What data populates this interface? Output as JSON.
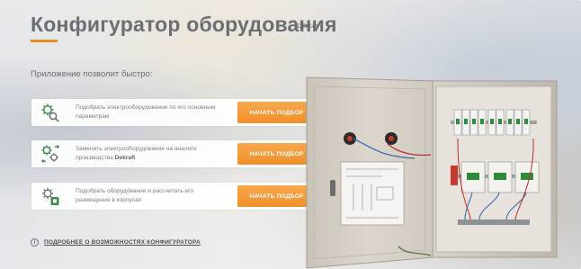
{
  "header": {
    "title": "Конфигуратор оборудования",
    "brand": "DEKraft"
  },
  "intro": "Приложение позволит быстро:",
  "features": [
    {
      "icon": "gear-search-icon",
      "text": "Подобрать электрооборудование по его основным параметрам",
      "button": "начать подбор"
    },
    {
      "icon": "gear-swap-icon",
      "text_before": "Заменить электрооборудование на аналоги производства ",
      "text_bold": "Dekraft",
      "button": "начать подбор"
    },
    {
      "icon": "gear-box-icon",
      "text": "Подобрать оборудование и рассчитать его размещение в корпусах",
      "button": "начать подбор"
    }
  ],
  "more_link": "подробнее о возможностях конфигуратора",
  "colors": {
    "accent": "#f08f2a",
    "title": "#6b6e73",
    "icon_green": "#3f8a4a"
  }
}
